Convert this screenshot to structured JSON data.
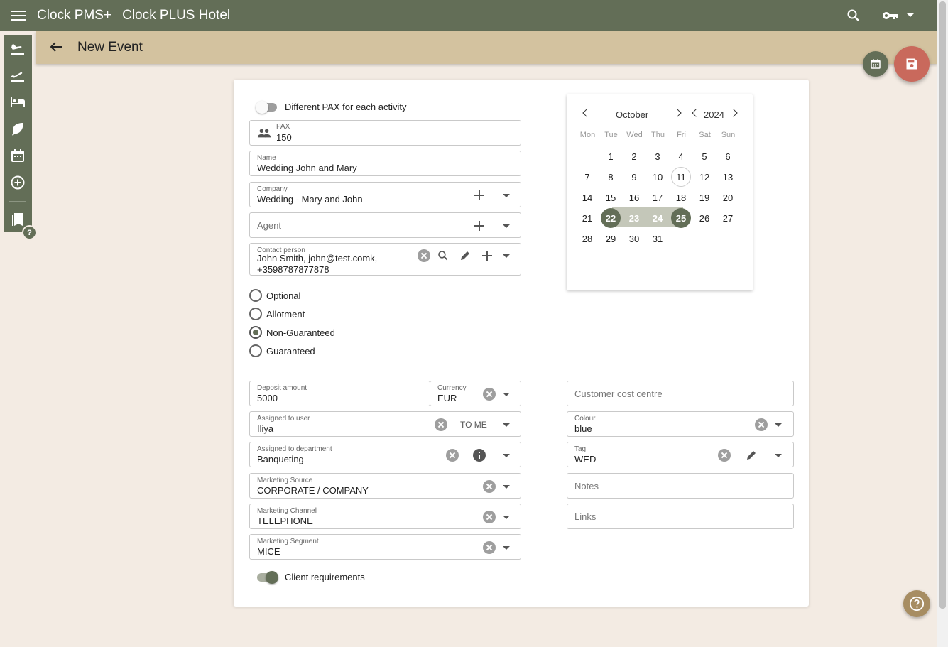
{
  "app": {
    "name": "Clock PMS+",
    "hotel": "Clock PLUS Hotel"
  },
  "page": {
    "title": "New Event"
  },
  "sidebar": {
    "items": [
      {
        "name": "arrivals",
        "icon": "plane-landing-icon"
      },
      {
        "name": "departures",
        "icon": "plane-takeoff-icon"
      },
      {
        "name": "in-house",
        "icon": "bed-icon"
      },
      {
        "name": "eco",
        "icon": "leaf-icon"
      },
      {
        "name": "calendar",
        "icon": "calendar-icon"
      },
      {
        "name": "add",
        "icon": "add-circle-icon"
      },
      {
        "name": "bookings",
        "icon": "bookmarks-icon"
      }
    ],
    "help": "?"
  },
  "form": {
    "different_pax_label": "Different PAX for each activity",
    "different_pax_on": false,
    "pax": {
      "label": "PAX",
      "value": "150"
    },
    "name": {
      "label": "Name",
      "value": "Wedding John and Mary"
    },
    "company": {
      "label": "Company",
      "value": "Wedding - Mary and John"
    },
    "agent": {
      "placeholder": "Agent"
    },
    "contact": {
      "label": "Contact person",
      "line1": "John Smith, john@test.comk,",
      "line2": "+3598787877878"
    },
    "status_options": [
      {
        "label": "Optional",
        "selected": false
      },
      {
        "label": "Allotment",
        "selected": false
      },
      {
        "label": "Non-Guaranteed",
        "selected": true
      },
      {
        "label": "Guaranteed",
        "selected": false
      }
    ],
    "deposit": {
      "label": "Deposit amount",
      "value": "5000"
    },
    "currency": {
      "label": "Currency",
      "value": "EUR"
    },
    "assigned_user": {
      "label": "Assigned to user",
      "value": "Iliya",
      "to_me": "TO ME"
    },
    "assigned_dept": {
      "label": "Assigned to department",
      "value": "Banqueting"
    },
    "marketing_source": {
      "label": "Marketing Source",
      "value": "CORPORATE / COMPANY"
    },
    "marketing_channel": {
      "label": "Marketing Channel",
      "value": "TELEPHONE"
    },
    "marketing_segment": {
      "label": "Marketing Segment",
      "value": "MICE"
    },
    "client_requirements_label": "Client requirements",
    "client_requirements_on": true,
    "customer_cost_centre": {
      "placeholder": "Customer cost centre"
    },
    "colour": {
      "label": "Colour",
      "value": "blue"
    },
    "tag": {
      "label": "Tag",
      "value": "WED"
    },
    "notes": {
      "placeholder": "Notes"
    },
    "links": {
      "placeholder": "Links"
    }
  },
  "calendar": {
    "month": "October",
    "year": "2024",
    "weekdays": [
      "Mon",
      "Tue",
      "Wed",
      "Thu",
      "Fri",
      "Sat",
      "Sun"
    ],
    "weeks": [
      [
        "",
        "1",
        "2",
        "3",
        "4",
        "5",
        "6"
      ],
      [
        "7",
        "8",
        "9",
        "10",
        "11",
        "12",
        "13"
      ],
      [
        "14",
        "15",
        "16",
        "17",
        "18",
        "19",
        "20"
      ],
      [
        "21",
        "22",
        "23",
        "24",
        "25",
        "26",
        "27"
      ],
      [
        "28",
        "29",
        "30",
        "31",
        "",
        "",
        ""
      ]
    ],
    "today": "11",
    "range_start": "22",
    "range_end": "25",
    "range_mid": [
      "23",
      "24"
    ]
  },
  "colors": {
    "primary": "#636e57",
    "subheader": "#d3c29f",
    "background": "#f3ebe3",
    "save_fab": "#c9695c",
    "help_fab": "#a78d62"
  }
}
